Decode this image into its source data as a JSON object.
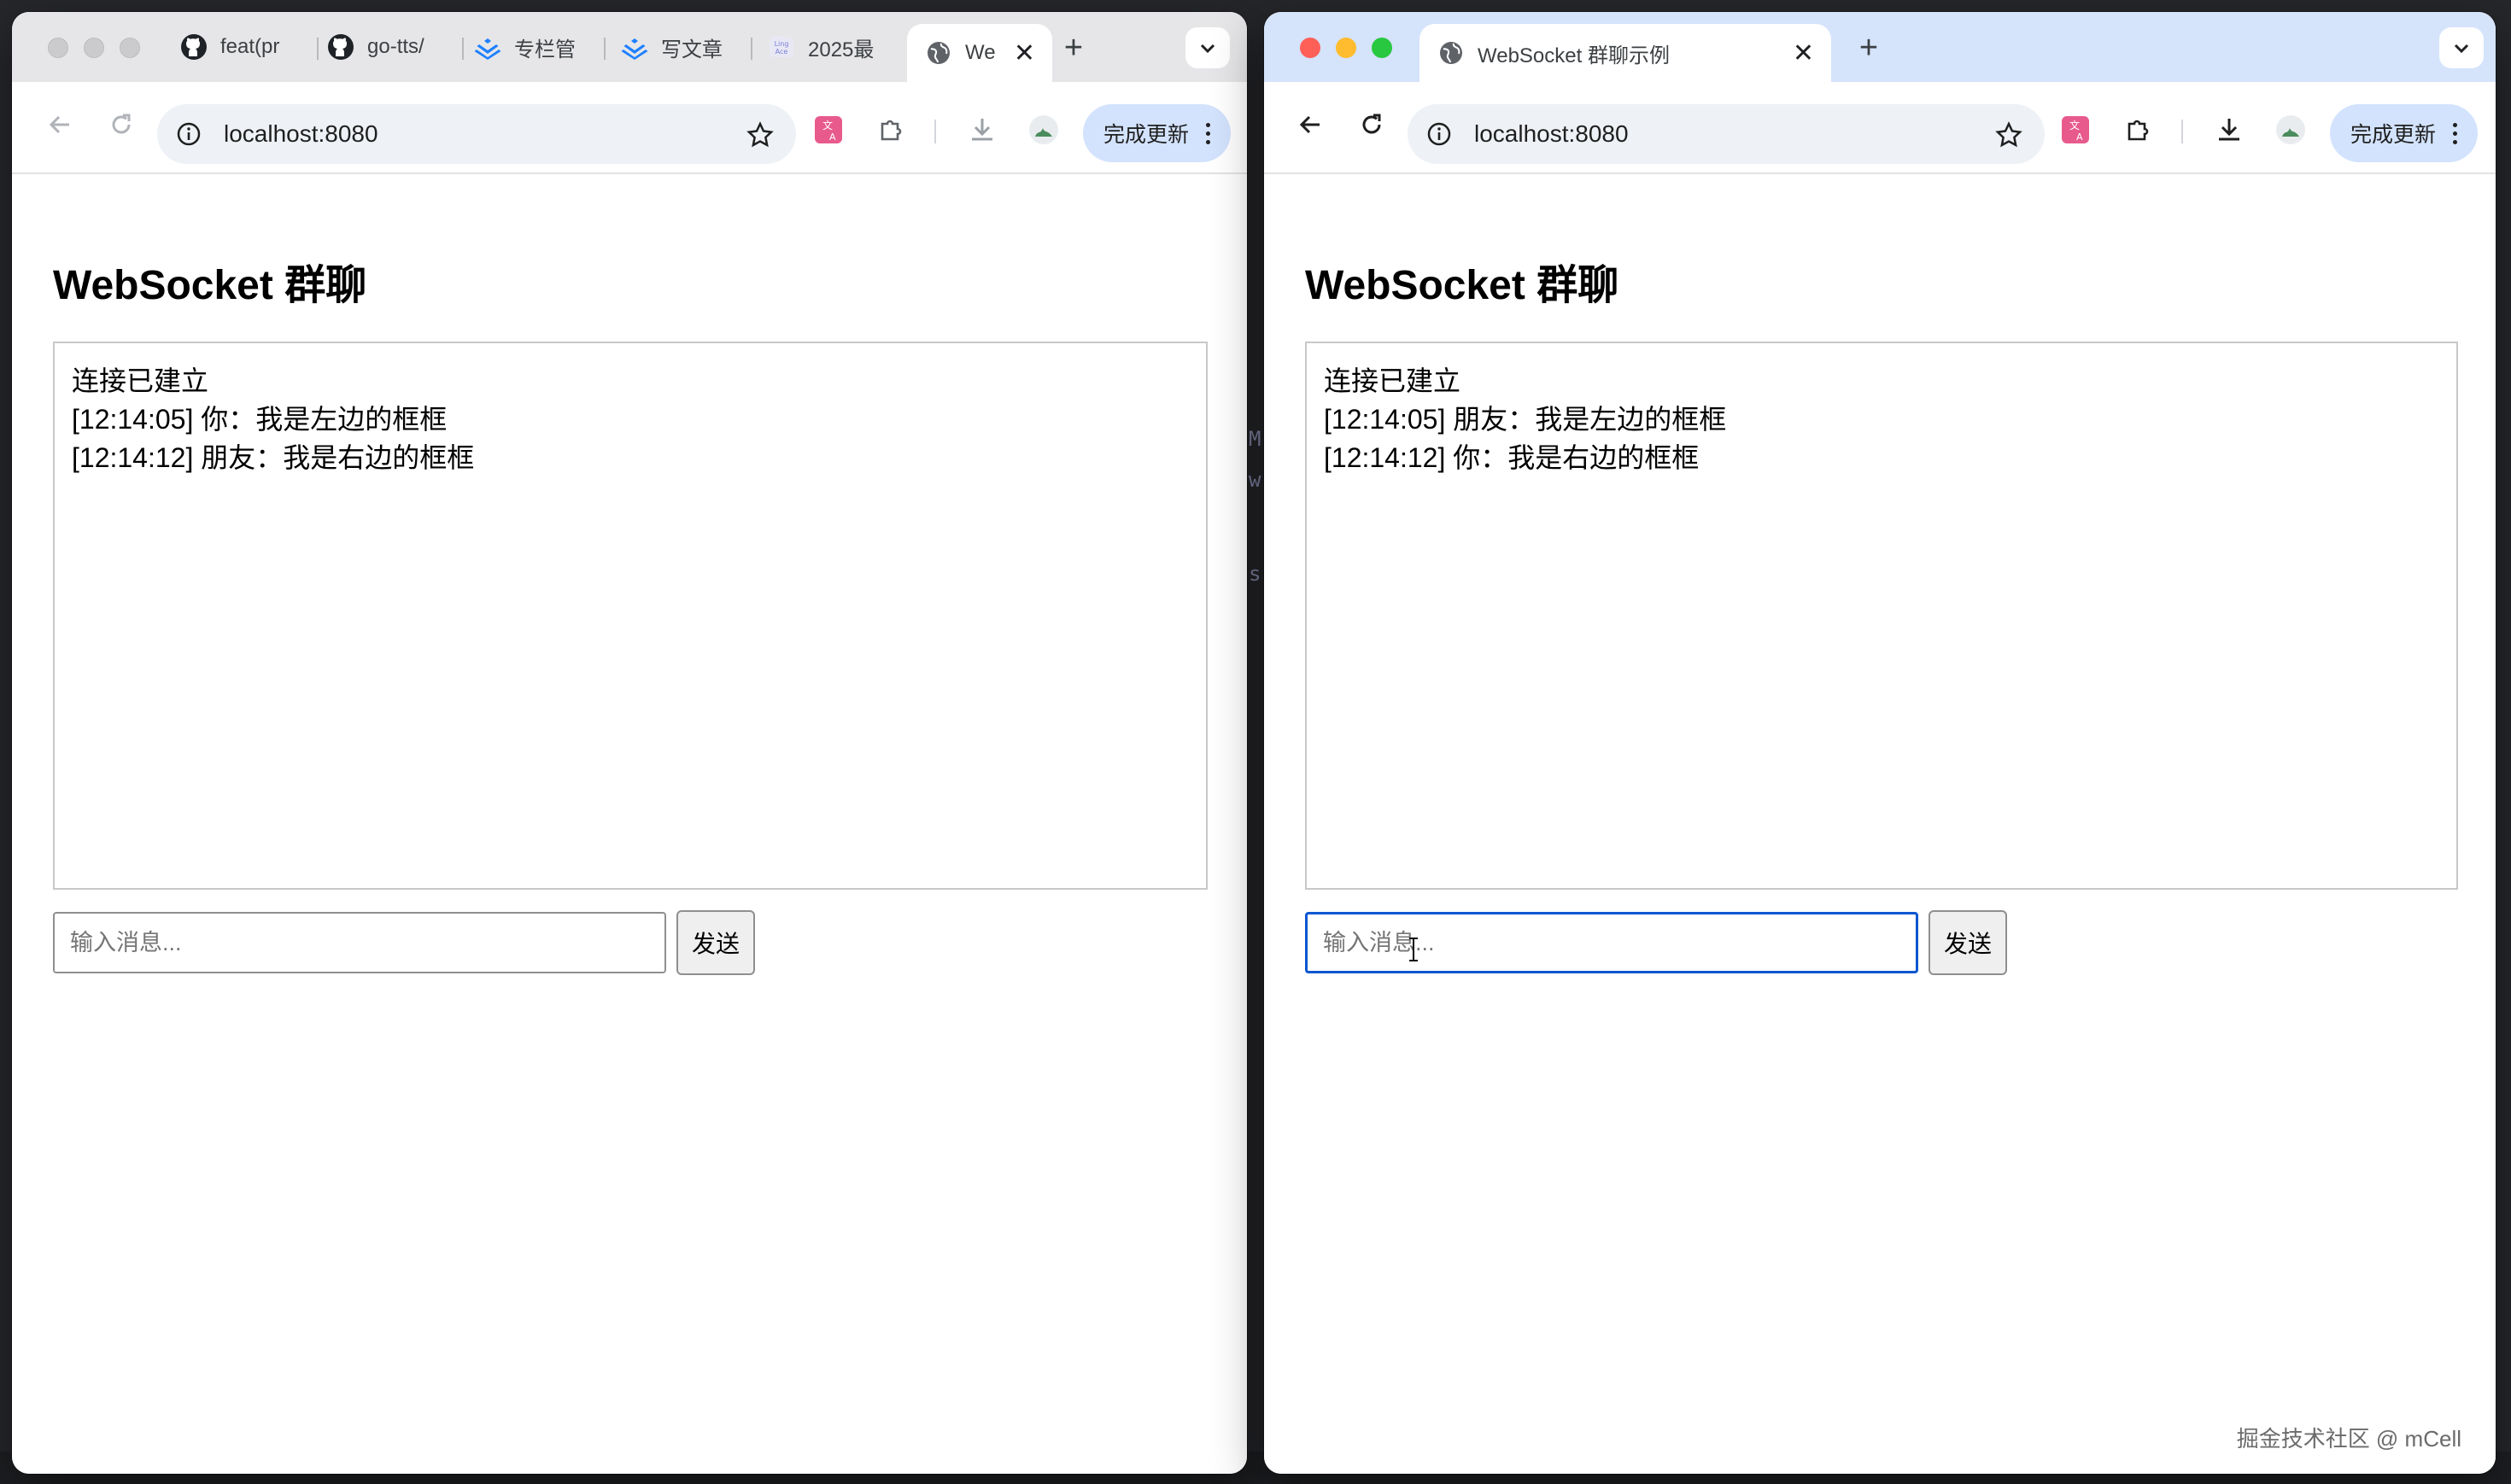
{
  "left_window": {
    "tabs": [
      {
        "label": "feat(pr",
        "icon": "github-icon"
      },
      {
        "label": "go-tts/",
        "icon": "github-icon"
      },
      {
        "label": "专栏管",
        "icon": "juejin-icon"
      },
      {
        "label": "写文章",
        "icon": "juejin-icon"
      },
      {
        "label": "2025最",
        "icon": "lingace-icon"
      }
    ],
    "active_tab": {
      "label": "We",
      "icon": "globe-icon"
    },
    "url": "localhost:8080",
    "update_button": "完成更新",
    "page": {
      "heading": "WebSocket 群聊",
      "messages": [
        "连接已建立",
        "[12:14:05] 你：我是左边的框框",
        "[12:14:12] 朋友：我是右边的框框"
      ],
      "input_placeholder": "输入消息...",
      "send_label": "发送"
    }
  },
  "right_window": {
    "active_tab": {
      "label": "WebSocket 群聊示例",
      "icon": "globe-icon"
    },
    "url": "localhost:8080",
    "update_button": "完成更新",
    "page": {
      "heading": "WebSocket 群聊",
      "messages": [
        "连接已建立",
        "[12:14:05] 朋友：我是左边的框框",
        "[12:14:12] 你：我是右边的框框"
      ],
      "input_placeholder": "输入消息...",
      "send_label": "发送"
    }
  },
  "watermark": "掘金技术社区 @ mCell",
  "colors": {
    "input_focus": "#0b57d0",
    "update_button_bg": "#d3e3fd",
    "right_tabstrip": "#d5e3fb",
    "left_tabstrip": "#e6e6e8"
  }
}
